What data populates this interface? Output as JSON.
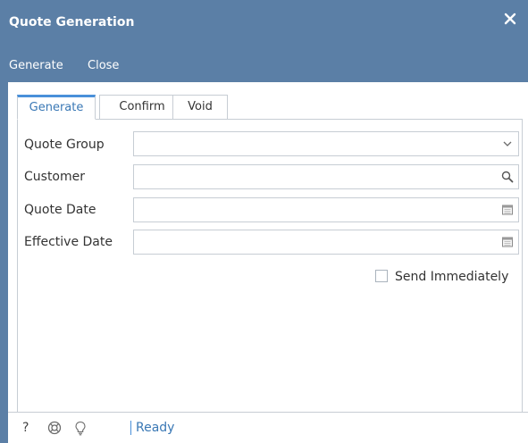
{
  "window": {
    "title": "Quote Generation",
    "close_icon": "close-icon"
  },
  "toolbar": {
    "generate_label": "Generate",
    "close_label": "Close"
  },
  "tabs": [
    {
      "label": "Generate",
      "active": true
    },
    {
      "label": "Confirm",
      "active": false
    },
    {
      "label": "Void",
      "active": false
    }
  ],
  "form": {
    "quote_group": {
      "label": "Quote Group",
      "value": "",
      "icon": "chevron-down-icon"
    },
    "customer": {
      "label": "Customer",
      "value": "",
      "icon": "search-icon"
    },
    "quote_date": {
      "label": "Quote Date",
      "value": "",
      "icon": "calendar-icon"
    },
    "effective_date": {
      "label": "Effective Date",
      "value": "",
      "icon": "calendar-icon"
    },
    "send_immediately": {
      "label": "Send Immediately",
      "checked": false
    }
  },
  "statusbar": {
    "help_icon": "help-icon",
    "support_icon": "lifebuoy-icon",
    "idea_icon": "lightbulb-icon",
    "help_glyph": "?",
    "status": "Ready"
  },
  "colors": {
    "titlebar": "#5b7fa6",
    "accent": "#4a90d9",
    "status_text": "#3a78b5"
  }
}
